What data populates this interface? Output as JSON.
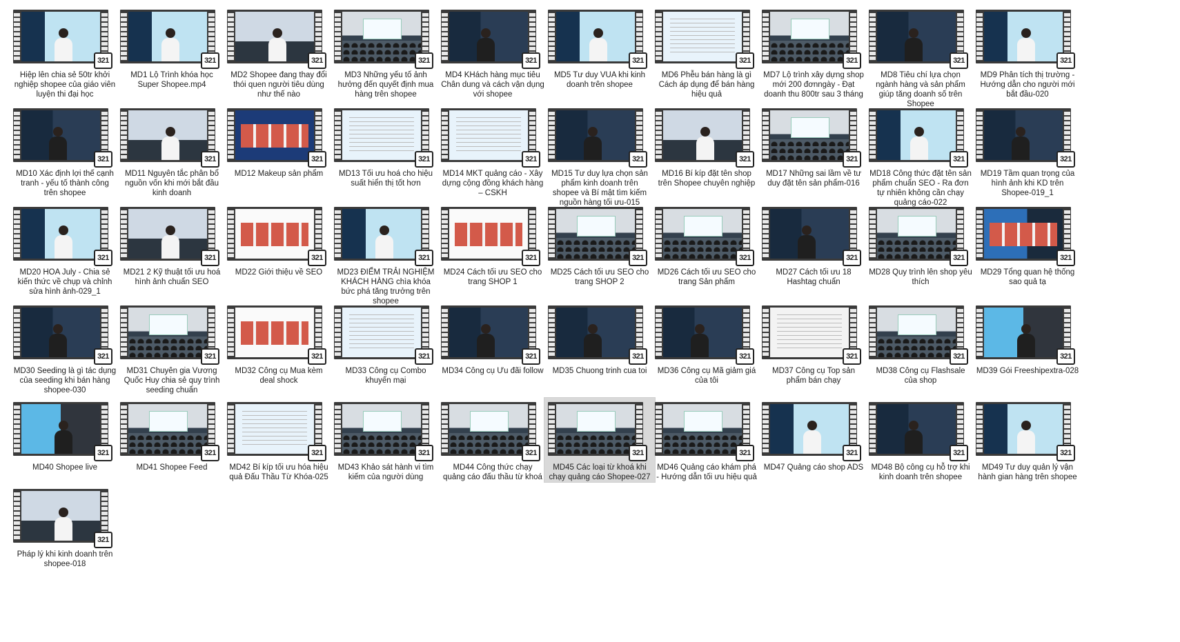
{
  "badge_text": "321",
  "videos": [
    {
      "label": "Hiệp lên chia sẻ 50tr khởi nghiệp shopee của giáo viên luyện thi đại học",
      "scene": "portrait"
    },
    {
      "label": "MD1 Lộ Trình khóa học Super Shopee.mp4",
      "scene": "portrait"
    },
    {
      "label": "MD2 Shopee đang thay đổi thói quen người tiêu dùng như thế nào",
      "scene": "stage"
    },
    {
      "label": "MD3 Những yếu tố ảnh hưởng đến quyết định mua hàng trên shopee",
      "scene": "audience"
    },
    {
      "label": "MD4 KHách hàng mục tiêu Chân dung và cách vận dụng với shopee",
      "scene": "dark"
    },
    {
      "label": "MD5 Tư duy VUA khi kinh doanh trên shopee",
      "scene": "portrait"
    },
    {
      "label": "MD6 Phễu bán hàng là gì Cách áp dụng để bán hàng hiệu quả",
      "scene": "slide"
    },
    {
      "label": "MD7 Lộ trình xây dựng shop mới 200 đơnngày - Đạt doanh thu 800tr sau 3 tháng",
      "scene": "audience"
    },
    {
      "label": "MD8 Tiêu chí lựa chọn ngành hàng và sản phẩm giúp tăng doanh số trên Shopee",
      "scene": "dark"
    },
    {
      "label": "MD9 Phân tích thị trường - Hướng dẫn cho người mới bắt đầu-020",
      "scene": "portrait"
    },
    {
      "label": "MD10 Xác định lợi thế cạnh tranh - yếu tố thành công trên shopee",
      "scene": "dark"
    },
    {
      "label": "MD11 Nguyên tắc phân bổ nguồn vốn khi mới bắt đầu kinh doanh",
      "scene": "stage"
    },
    {
      "label": "MD12 Makeup sản phẩm",
      "scene": "title"
    },
    {
      "label": "MD13 Tối ưu hoá cho hiệu suất hiển thị tốt hơn",
      "scene": "slide"
    },
    {
      "label": "MD14 MKT quảng cáo - Xây dựng cộng đồng khách hàng – CSKH",
      "scene": "slide"
    },
    {
      "label": "MD15 Tư duy lựa chọn sản phẩm kinh doanh trên shopee và Bí mật tìm kiếm nguồn hàng tối ưu-015",
      "scene": "dark"
    },
    {
      "label": "MD16 Bí kíp đặt tên shop trên Shopee chuyên nghiệp",
      "scene": "stage"
    },
    {
      "label": "MD17 Những sai lầm về tư duy đặt tên sản phẩm-016",
      "scene": "audience"
    },
    {
      "label": "MD18 Công thức đặt tên sản phẩm chuẩn SEO - Ra đơn tự nhiên không cần chạy quảng cáo-022",
      "scene": "portrait"
    },
    {
      "label": "MD19 Tầm quan trọng của hình ảnh khi KD trên Shopee-019_1",
      "scene": "dark"
    },
    {
      "label": "MD20 HOA July - Chia sẻ kiến thức về chụp và chỉnh sửa hình ảnh-029_1",
      "scene": "portrait"
    },
    {
      "label": "MD21 2 Kỹ thuật tối ưu hoá hình ảnh chuẩn SEO",
      "scene": "stage"
    },
    {
      "label": "MD22 Giới thiệu về SEO",
      "scene": "browser"
    },
    {
      "label": "MD23 ĐIỂM TRẢI NGHIỆM KHÁCH HÀNG chìa khóa bức phá tăng trưởng trên shopee",
      "scene": "portrait"
    },
    {
      "label": "MD24 Cách tối ưu SEO cho trang SHOP 1",
      "scene": "browser"
    },
    {
      "label": "MD25 Cách tối ưu SEO cho trang SHOP 2",
      "scene": "audience"
    },
    {
      "label": "MD26 Cách tối ưu SEO cho trang Sản phẩm",
      "scene": "audience"
    },
    {
      "label": "MD27 Cách tối ưu 18 Hashtag chuẩn",
      "scene": "dark"
    },
    {
      "label": "MD28 Quy trình lên shop yêu thích",
      "scene": "audience"
    },
    {
      "label": "MD29 Tổng quan hệ thống sao quả tạ",
      "scene": "blue"
    },
    {
      "label": "MD30 Seeding là gì tác dụng của seeding khi bán hàng shopee-030",
      "scene": "dark"
    },
    {
      "label": "MD31 Chuyên gia Vương Quốc Huy chia sẻ quy trình seeding chuẩn",
      "scene": "audience"
    },
    {
      "label": "MD32 Công cụ Mua kèm deal shock",
      "scene": "browser"
    },
    {
      "label": "MD33 Công cụ Combo khuyến mại",
      "scene": "slide"
    },
    {
      "label": "MD34 Công cụ Ưu đãi follow",
      "scene": "dark"
    },
    {
      "label": "MD35 Chuong trinh cua toi",
      "scene": "dark"
    },
    {
      "label": "MD36 Công cụ Mã giảm giá của tôi",
      "scene": "dark"
    },
    {
      "label": "MD37 Công cụ Top sản phẩm bán chạy",
      "scene": "doc"
    },
    {
      "label": "MD38 Công cụ Flashsale của shop",
      "scene": "audience"
    },
    {
      "label": "MD39 Gói Freeshipextra-028",
      "scene": "red"
    },
    {
      "label": "MD40 Shopee live",
      "scene": "red"
    },
    {
      "label": "MD41 Shopee Feed",
      "scene": "audience"
    },
    {
      "label": "MD42 Bí kíp tối ưu hóa hiệu quả Đấu Thầu Từ Khóa-025",
      "scene": "slide"
    },
    {
      "label": "MD43 Khảo sát hành vi tìm kiếm của người dùng",
      "scene": "audience"
    },
    {
      "label": "MD44 Công thức chạy quảng cáo đấu thầu từ khoá",
      "scene": "audience"
    },
    {
      "label": "MD45 Các loại từ khoá khi chạy quảng cáo Shopee-027",
      "scene": "audience",
      "selected": true
    },
    {
      "label": "MD46 Quảng cáo khám phá - Hướng dẫn tối ưu hiệu quả",
      "scene": "audience"
    },
    {
      "label": "MD47 Quảng cáo shop ADS",
      "scene": "portrait"
    },
    {
      "label": "MD48 Bộ công cụ hỗ trợ khi kinh doanh trên shopee",
      "scene": "dark"
    },
    {
      "label": "MD49 Tư duy quản lý vận hành gian hàng trên shopee",
      "scene": "portrait"
    },
    {
      "label": "Pháp lý khi kinh doanh trên shopee-018",
      "scene": "stage"
    }
  ]
}
